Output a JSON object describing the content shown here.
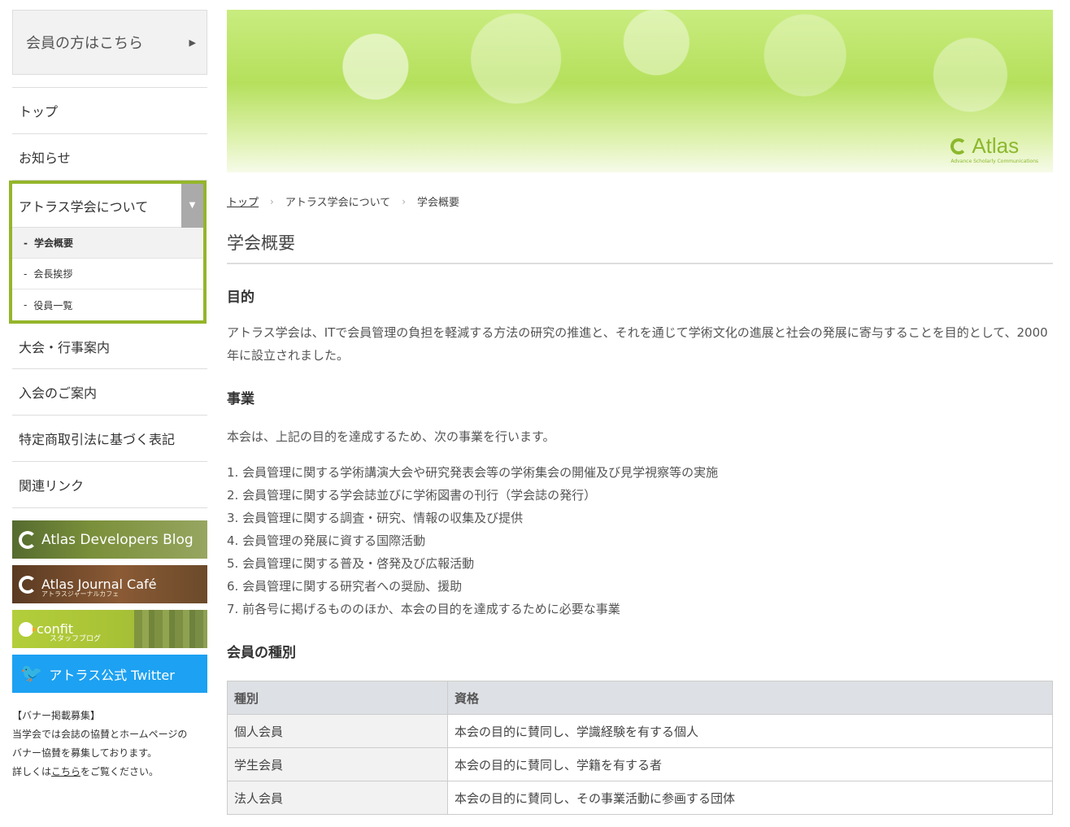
{
  "sidebar": {
    "member_button": "会員の方はこちら",
    "member_arrow": "▶",
    "items": {
      "top": "トップ",
      "news": "お知らせ",
      "about": "アトラス学会について",
      "events": "大会・行事案内",
      "join": "入会のご案内",
      "law": "特定商取引法に基づく表記",
      "links": "関連リンク"
    },
    "about_toggle": "▼",
    "sub_items": [
      {
        "label": "学会概要",
        "active": true
      },
      {
        "label": "会長挨拶",
        "active": false
      },
      {
        "label": "役員一覧",
        "active": false
      }
    ],
    "sub_dash": "-",
    "banners": {
      "blog": "Atlas Developers Blog",
      "cafe": "Atlas Journal Café",
      "cafe_sub": "アトラスジャーナルカフェ",
      "confit": "confit",
      "confit_sub": "スタッフブログ",
      "twitter": "アトラス公式 Twitter"
    },
    "notice": {
      "title": "【バナー掲載募集】",
      "line1": "当学会では会誌の協賛とホームページの",
      "line2": "バナー協賛を募集しております。",
      "line3_pre": "詳しくは",
      "line3_link": "こちら",
      "line3_post": "をご覧ください。"
    }
  },
  "hero": {
    "brand_name": "Atlas",
    "brand_tagline": "Advance Scholarly Communications"
  },
  "breadcrumb": {
    "home": "トップ",
    "section": "アトラス学会について",
    "current": "学会概要",
    "separator": "›"
  },
  "page_title": "学会概要",
  "sections": {
    "purpose": {
      "heading": "目的",
      "text": "アトラス学会は、ITで会員管理の負担を軽減する方法の研究の推進と、それを通じて学術文化の進展と社会の発展に寄与することを目的として、2000年に設立されました。"
    },
    "business": {
      "heading": "事業",
      "intro": "本会は、上記の目的を達成するため、次の事業を行います。",
      "items": [
        "1. 会員管理に関する学術講演大会や研究発表会等の学術集会の開催及び見学視察等の実施",
        "2. 会員管理に関する学会誌並びに学術図書の刊行（学会誌の発行）",
        "3. 会員管理に関する調査・研究、情報の収集及び提供",
        "4. 会員管理の発展に資する国際活動",
        "5. 会員管理に関する普及・啓発及び広報活動",
        "6. 会員管理に関する研究者への奨励、援助",
        "7. 前各号に掲げるもののほか、本会の目的を達成するために必要な事業"
      ]
    },
    "member_types": {
      "heading": "会員の種別",
      "columns": [
        "種別",
        "資格"
      ],
      "rows": [
        [
          "個人会員",
          "本会の目的に賛同し、学識経験を有する個人"
        ],
        [
          "学生会員",
          "本会の目的に賛同し、学籍を有する者"
        ],
        [
          "法人会員",
          "本会の目的に賛同し、その事業活動に参画する団体"
        ]
      ]
    }
  },
  "colors": {
    "accent_green": "#94b52a",
    "twitter_blue": "#1da1f2"
  }
}
